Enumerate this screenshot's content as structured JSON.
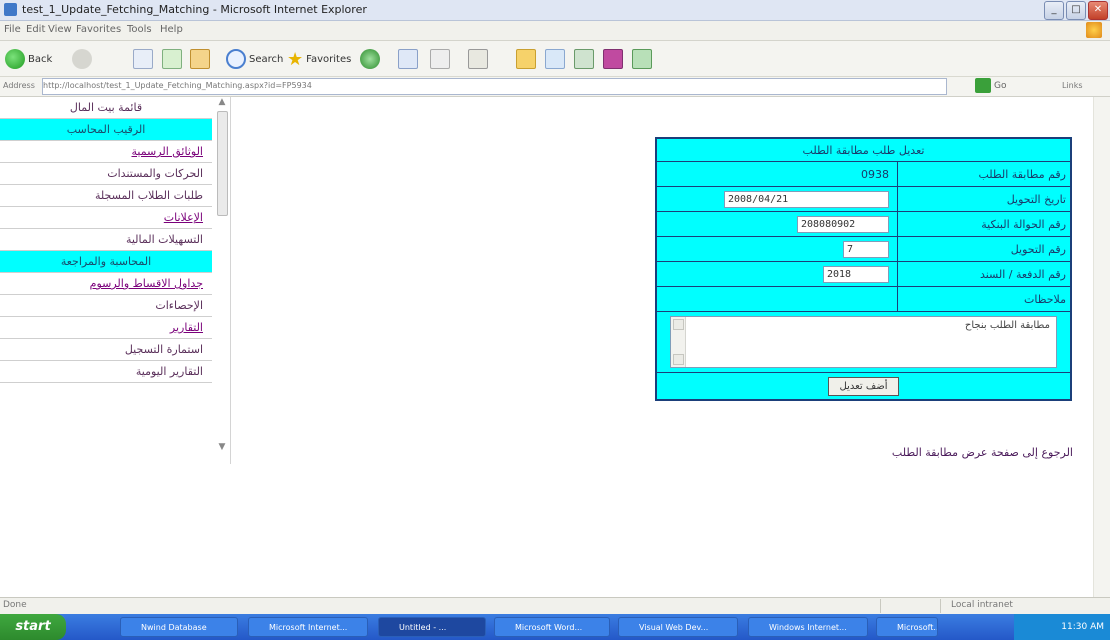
{
  "window": {
    "title": "test_1_Update_Fetching_Matching - Microsoft Internet Explorer"
  },
  "menubar": {
    "items": [
      "File",
      "Edit",
      "View",
      "Favorites",
      "Tools",
      "Help"
    ]
  },
  "toolbar": {
    "back_label": "Back",
    "search_label": "Search",
    "favorites_label": "Favorites"
  },
  "address": {
    "label": "Address",
    "url": "http://localhost/test_1_Update_Fetching_Matching.aspx?id=FP5934",
    "go_label": "Go",
    "links_label": "Links"
  },
  "sidebar": {
    "items": [
      {
        "label": "قائمة بيت المال",
        "style": "center"
      },
      {
        "label": "الرقيب المحاسب",
        "style": "hl"
      },
      {
        "label": "الوثائق الرسمية",
        "style": "link"
      },
      {
        "label": "الحركات والمستندات",
        "style": ""
      },
      {
        "label": "طلبات الطلاب المسجلة",
        "style": ""
      },
      {
        "label": "الإعلانات",
        "style": "link"
      },
      {
        "label": "التسهيلات المالية",
        "style": ""
      },
      {
        "label": "المحاسبة والمراجعة",
        "style": "hl"
      },
      {
        "label": "جداول الاقساط والرسوم",
        "style": "link"
      },
      {
        "label": "الإحصاءات",
        "style": ""
      },
      {
        "label": "التقارير",
        "style": "link"
      },
      {
        "label": "استمارة التسجيل",
        "style": ""
      },
      {
        "label": "التقارير اليومية",
        "style": ""
      }
    ]
  },
  "form": {
    "header": "تعديل طلب مطابقة الطلب",
    "fields": [
      {
        "label": "رقم مطابقة الطلب",
        "value": "0938",
        "kind": "text"
      },
      {
        "label": "تاريخ التحويل",
        "value": "2008/04/21",
        "kind": "input",
        "w": 165
      },
      {
        "label": "رقم الحوالة البنكية",
        "value": "208080902",
        "kind": "input",
        "w": 92
      },
      {
        "label": "رقم التحويل",
        "value": "7",
        "kind": "input",
        "w": 46
      },
      {
        "label": "رقم الدفعة / السند",
        "value": "2018",
        "kind": "input",
        "w": 66
      }
    ],
    "notes_label": "ملاحظات",
    "notes_value": "مطابقة الطلب بنجاح",
    "submit_label": "أضف تعديل"
  },
  "back_link": "الرجوع إلى صفحة عرض مطابقة الطلب",
  "statusbar": {
    "left": "Done",
    "right": "Local intranet"
  },
  "taskbar": {
    "start_label": "start",
    "tasks": [
      "Nwind Database",
      "Microsoft Internet...",
      "Untitled - ...",
      "Microsoft Word...",
      "Visual Web Dev...",
      "Windows Internet...",
      "Microsoft..."
    ],
    "clock": "11:30 AM"
  }
}
